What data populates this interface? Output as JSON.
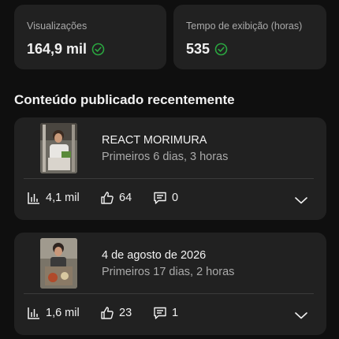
{
  "colors": {
    "background": "#0f0f0f",
    "card": "#212121",
    "check": "#2ba640",
    "muted": "#aaaaaa"
  },
  "stats": [
    {
      "label": "Visualizações",
      "value": "164,9 mil",
      "status_icon": "check-circle-icon"
    },
    {
      "label": "Tempo de exibição (horas)",
      "value": "535",
      "status_icon": "check-circle-icon"
    }
  ],
  "section_title": "Conteúdo publicado recentemente",
  "videos": [
    {
      "title": "REACT MORIMURA",
      "subtitle": "Primeiros 6 dias, 3 horas",
      "views": "4,1 mil",
      "likes": "64",
      "comments": "0"
    },
    {
      "title": "4 de agosto de 2026",
      "subtitle": "Primeiros 17 dias, 2 horas",
      "views": "1,6 mil",
      "likes": "23",
      "comments": "1"
    }
  ]
}
